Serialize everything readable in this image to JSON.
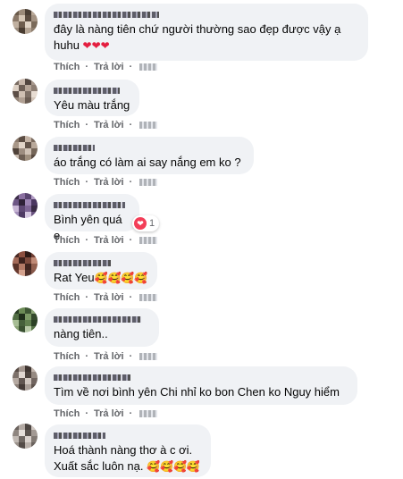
{
  "actions": {
    "like_label": "Thích",
    "reply_label": "Trả lời",
    "separator": "·"
  },
  "comments": [
    {
      "text": "đây là nàng tiên chứ người thường sao đẹp được vậy ạ\nhuhu ",
      "emoji": "❤❤❤"
    },
    {
      "text": "Yêu màu trắng"
    },
    {
      "text": "áo trắng có làm ai say nắng em ko ?"
    },
    {
      "text": "Bình yên quá e",
      "reaction_count": "1",
      "reaction_icon": "heart-icon"
    },
    {
      "text": "Rat Yeu",
      "emoji": "🥰🥰🥰🥰"
    },
    {
      "text": "nàng tiên.."
    },
    {
      "text": "Tìm về nơi bình yên Chi nhỉ ko bon Chen ko Nguy hiểm"
    },
    {
      "text": "Hoá thành nàng thơ à c ơi.\nXuất sắc luôn nạ. ",
      "emoji": "🥰🥰🥰🥰"
    }
  ],
  "colors": {
    "bubble": "#f0f2f5",
    "action_text": "#65676b",
    "heart": "#e41e3f",
    "reaction_badge": "#f33e58"
  }
}
